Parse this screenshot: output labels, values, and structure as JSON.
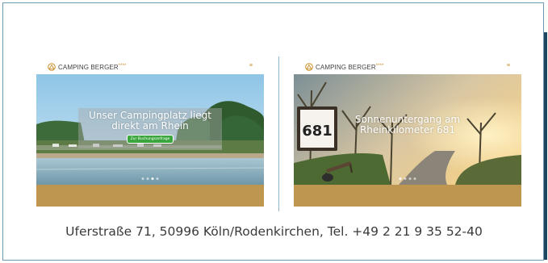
{
  "cards": [
    {
      "logo": {
        "name": "CAMPING BERGER",
        "stars": "****",
        "icon": "camping-logo-icon"
      },
      "menu_icon": "menu-icon",
      "caption": "Unser Campingplatz liegt direkt am Rhein",
      "cta_label": "Zur Buchungsanfrage",
      "slides": 4,
      "active_slide": 2
    },
    {
      "logo": {
        "name": "CAMPING BERGER",
        "stars": "****",
        "icon": "camping-logo-icon"
      },
      "menu_icon": "menu-icon",
      "caption": "Sonnenuntergang am Rheinkilometer 681",
      "sign_text": "681",
      "slides": 4,
      "active_slide": 1
    }
  ],
  "colors": {
    "brand_gold": "#bf9650",
    "cta_green": "#3aa63d",
    "frame_border": "#6f98b2"
  },
  "address": "Uferstraße 71, 50996 Köln/Rodenkirchen, Tel. +49 2 21 9 35 52-40"
}
